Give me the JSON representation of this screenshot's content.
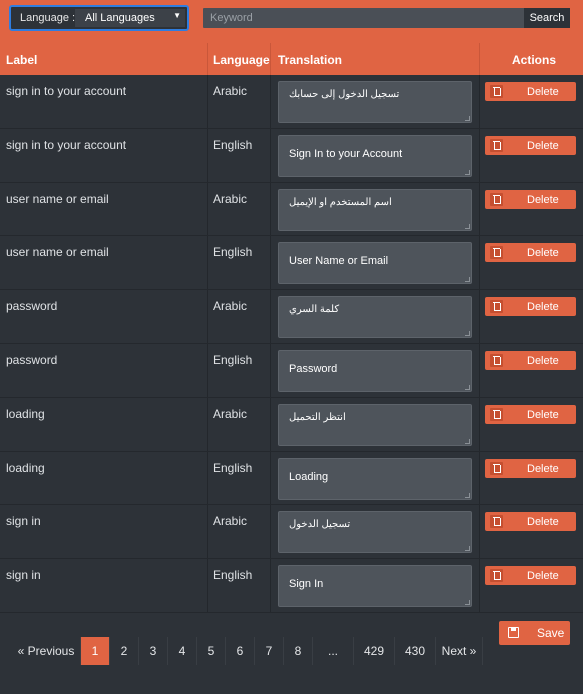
{
  "toolbar": {
    "language_label": "Language :",
    "language_value": "All Languages",
    "search_placeholder": "Keyword",
    "search_label": "Search"
  },
  "table": {
    "headers": {
      "label": "Label",
      "language": "Language",
      "translation": "Translation",
      "actions": "Actions"
    },
    "delete_label": "Delete",
    "rows": [
      {
        "label": "sign in to your account",
        "language": "Arabic",
        "translation": "تسجيل الدخول إلى حسابك"
      },
      {
        "label": "sign in to your account",
        "language": "English",
        "translation": "Sign In to your Account"
      },
      {
        "label": "user name or email",
        "language": "Arabic",
        "translation": "اسم المستخدم او الإيميل"
      },
      {
        "label": "user name or email",
        "language": "English",
        "translation": "User Name or Email"
      },
      {
        "label": "password",
        "language": "Arabic",
        "translation": "كلمة السري"
      },
      {
        "label": "password",
        "language": "English",
        "translation": "Password"
      },
      {
        "label": "loading",
        "language": "Arabic",
        "translation": "انتظر التحميل"
      },
      {
        "label": "loading",
        "language": "English",
        "translation": "Loading"
      },
      {
        "label": "sign in",
        "language": "Arabic",
        "translation": "تسجيل الدخول"
      },
      {
        "label": "sign in",
        "language": "English",
        "translation": "Sign In"
      }
    ]
  },
  "footer": {
    "save_label": "Save"
  },
  "pagination": {
    "previous": "« Previous",
    "next": "Next »",
    "pages": [
      "1",
      "2",
      "3",
      "4",
      "5",
      "6",
      "7",
      "8",
      "...",
      "429",
      "430"
    ],
    "current": "1"
  },
  "colors": {
    "accent": "#e06443",
    "background": "#2d3238",
    "input": "#4e545b",
    "focus_ring": "#2f7de0"
  },
  "icons": {
    "delete": "trash-icon",
    "save": "floppy-disk-icon",
    "dropdown": "caret-down-icon"
  }
}
